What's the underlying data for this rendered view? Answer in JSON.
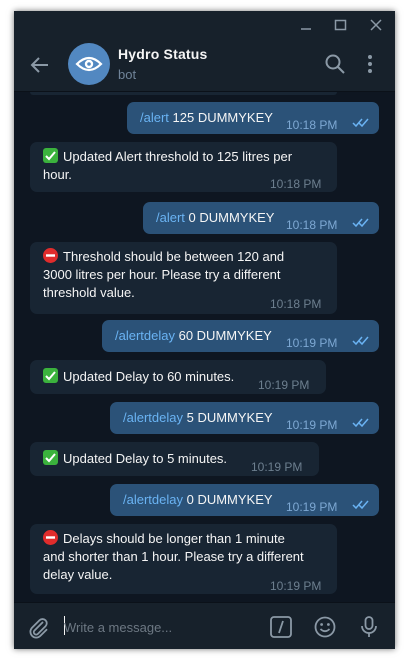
{
  "chat": {
    "title": "Hydro Status",
    "subtitle": "bot"
  },
  "messages": [
    {
      "dir": "out",
      "command": "/alert",
      "text": " 125 DUMMYKEY",
      "time": "10:18 PM"
    },
    {
      "dir": "in",
      "emoji": "check",
      "text": "Updated Alert threshold to 125 litres per",
      "text2": "hour.",
      "time": "10:18 PM"
    },
    {
      "dir": "out",
      "command": "/alert",
      "text": " 0 DUMMYKEY",
      "time": "10:18 PM"
    },
    {
      "dir": "in",
      "emoji": "stop",
      "text": "Threshold should be between 120 and",
      "text2": "3000 litres per hour. Please try a different",
      "text3": "threshold value.",
      "time": "10:18 PM"
    },
    {
      "dir": "out",
      "command": "/alertdelay",
      "text": " 60 DUMMYKEY",
      "time": "10:19 PM"
    },
    {
      "dir": "in",
      "emoji": "check",
      "text": "Updated Delay to 60 minutes.",
      "time": "10:19 PM"
    },
    {
      "dir": "out",
      "command": "/alertdelay",
      "text": " 5 DUMMYKEY",
      "time": "10:19 PM"
    },
    {
      "dir": "in",
      "emoji": "check",
      "text": "Updated Delay to 5 minutes.",
      "time": "10:19 PM"
    },
    {
      "dir": "out",
      "command": "/alertdelay",
      "text": " 0 DUMMYKEY",
      "time": "10:19 PM"
    },
    {
      "dir": "in",
      "emoji": "stop",
      "text": "Delays should be longer than 1 minute",
      "text2": "and shorter than 1 hour. Please try a different",
      "text3": "delay value.",
      "time": "10:19 PM"
    }
  ],
  "composer": {
    "placeholder": "Write a message..."
  },
  "icons": {
    "window_minimize": "minimize-icon",
    "window_maximize": "maximize-icon",
    "window_close": "close-icon",
    "back": "back-arrow-icon",
    "avatar": "eye-icon",
    "search": "search-icon",
    "more": "more-vertical-icon",
    "attach": "paperclip-icon",
    "commands": "slash-command-icon",
    "emoji": "smiley-icon",
    "voice": "microphone-icon",
    "read": "double-check-icon",
    "emoji_check": "check-mark-button-icon",
    "emoji_stop": "no-entry-icon"
  },
  "colors": {
    "background": "#0e1621",
    "panel": "#17212b",
    "outgoing_bubble": "#2b5278",
    "incoming_bubble": "#182533",
    "command_link": "#6ab3f3",
    "avatar": "#5288c1"
  }
}
